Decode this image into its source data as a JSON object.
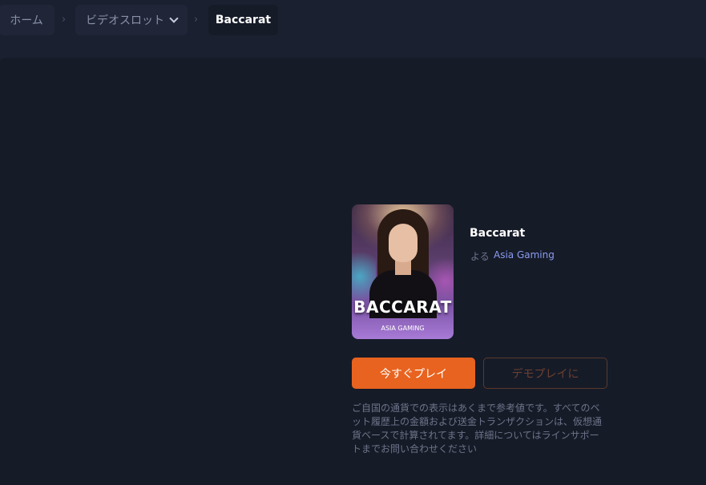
{
  "breadcrumb": {
    "home": "ホーム",
    "category": "ビデオスロット",
    "current": "Baccarat",
    "separator": "›"
  },
  "game": {
    "title": "Baccarat",
    "by_label": "よる",
    "provider": "Asia Gaming",
    "thumbnail_title": "BACCARAT",
    "thumbnail_subtitle": "ASIA GAMING"
  },
  "actions": {
    "play_label": "今すぐプレイ",
    "demo_label": "デモプレイに"
  },
  "disclaimer": "ご自国の通貨での表示はあくまで参考値です。すべてのベット履歴上の金額および送金トランザクションは、仮想通貨ベースで計算されてます。詳細についてはラインサポートまでお問い合わせください",
  "colors": {
    "accent": "#e8631f",
    "provider_link": "#8a9cf0",
    "background": "#161b28"
  }
}
